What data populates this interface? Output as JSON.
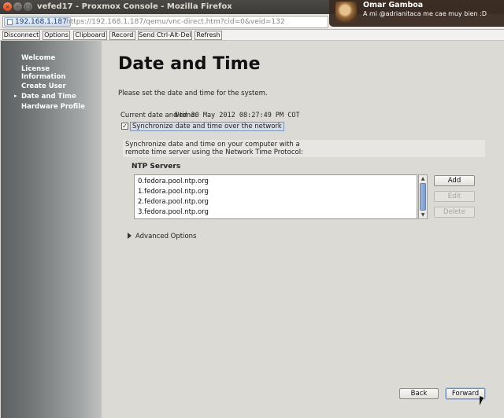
{
  "window": {
    "title": "vefed17 - Proxmox Console - Mozilla Firefox"
  },
  "browser": {
    "site_identity": "192.168.1.187",
    "url": "https://192.168.1.187/qemu/vnc-direct.htm?cid=0&veid=132"
  },
  "notification": {
    "name": "Omar Gamboa",
    "message": "A mi @adrianitaca me cae muy bien :D"
  },
  "toolbar": {
    "buttons": [
      "Disconnect",
      "Options",
      "Clipboard",
      "Record",
      "Send Ctrl-Alt-Del",
      "Refresh"
    ]
  },
  "sidebar": {
    "items": [
      {
        "label": "Welcome"
      },
      {
        "label": "License Information"
      },
      {
        "label": "Create User"
      },
      {
        "label": "Date and Time",
        "current": true
      },
      {
        "label": "Hardware Profile"
      }
    ]
  },
  "page": {
    "title": "Date and Time",
    "intro": "Please set the date and time for the system.",
    "current_label": "Current date and time:",
    "current_value": "Wed 30 May 2012 08:27:49 PM COT",
    "sync_label": "Synchronize date and time over the network",
    "sync_checked": true,
    "description_line1": "Synchronize date and time on your computer with a",
    "description_line2": "remote time server using the Network Time Protocol:",
    "ntp_label": "NTP Servers",
    "ntp_servers": [
      "0.fedora.pool.ntp.org",
      "1.fedora.pool.ntp.org",
      "2.fedora.pool.ntp.org",
      "3.fedora.pool.ntp.org"
    ],
    "add_label": "Add",
    "edit_label": "Edit",
    "delete_label": "Delete",
    "advanced_label": "Advanced Options",
    "back_label": "Back",
    "forward_label": "Forward"
  },
  "icons": {
    "checkbox": "✓",
    "current_marker": "▸"
  }
}
